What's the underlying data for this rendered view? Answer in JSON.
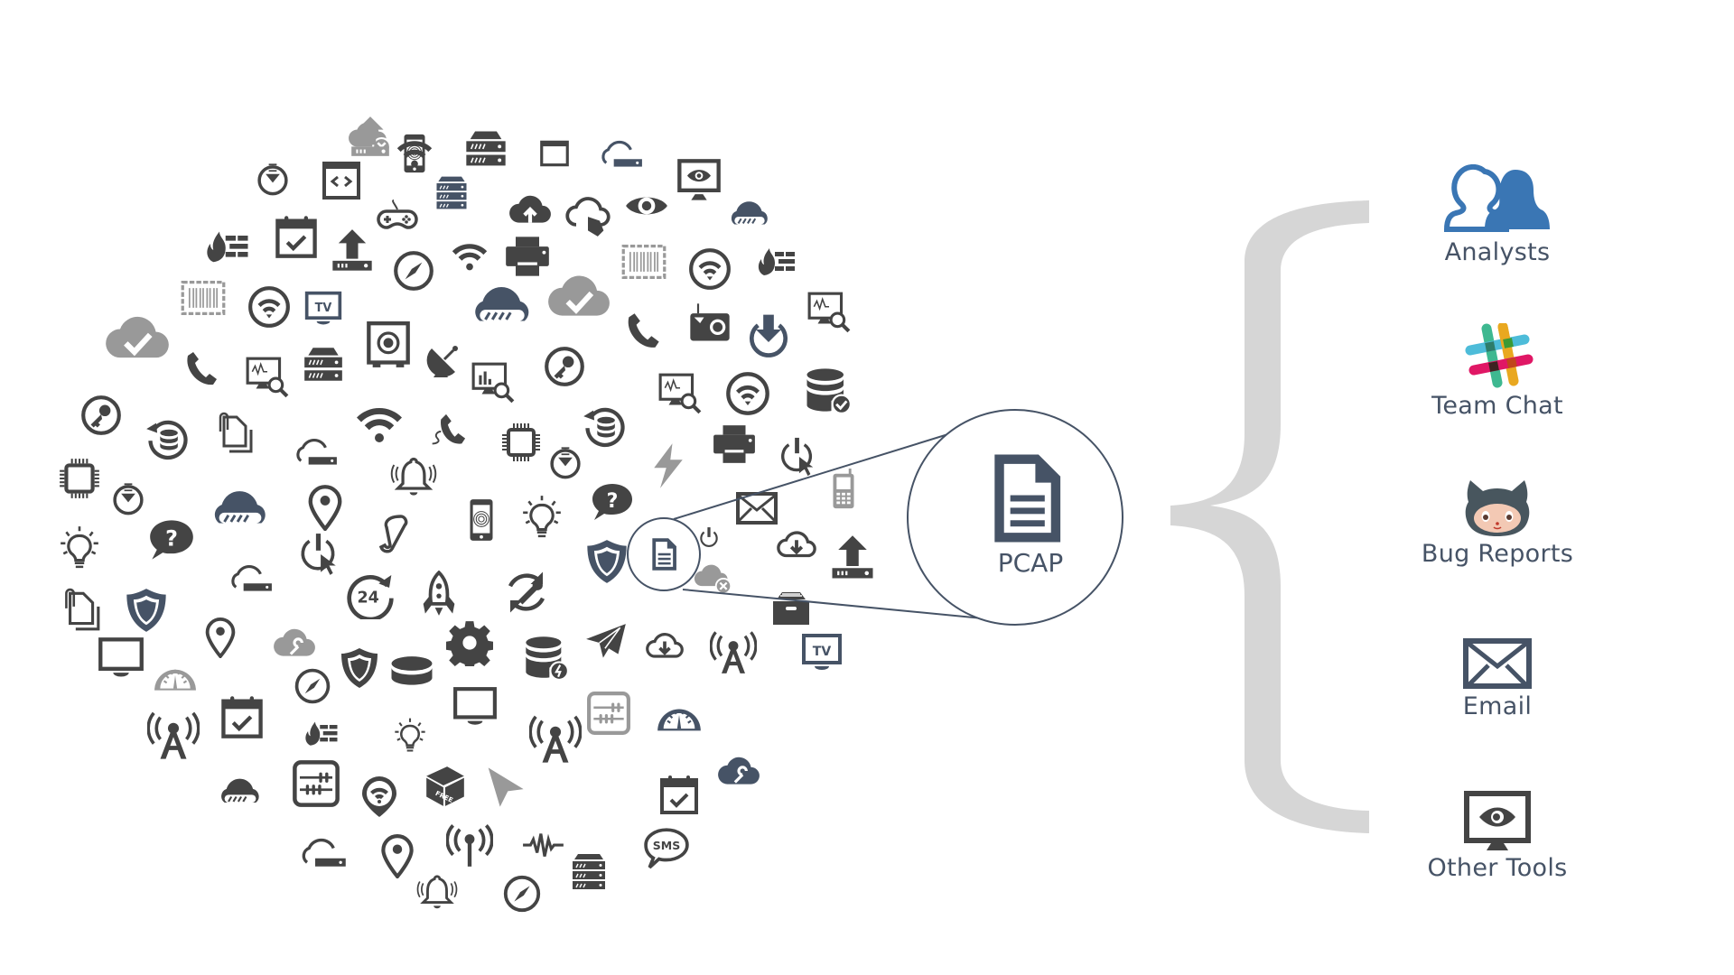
{
  "colors": {
    "icon_dark": "#444444",
    "icon_light": "#999999",
    "icon_slate": "#465366",
    "brace": "#d6d6d6",
    "label": "#465366",
    "analysts_blue": "#3a76b4"
  },
  "icon_cloud": {
    "icons": [
      "cloud-error-icon",
      "fingerprint-phone-icon",
      "server-icon",
      "browser-window-icon",
      "cloud-server-icon",
      "download-circle-icon",
      "code-window-icon",
      "server-stack-icon",
      "gamepad-icon",
      "cloud-upload-icon",
      "cloud-touch-icon",
      "eye-icon",
      "monitor-eye-icon",
      "cloud-progress-icon",
      "firewall-icon",
      "calendar-check-icon",
      "upload-server-icon",
      "compass-icon",
      "wifi-icon",
      "printer-icon",
      "barcode-icon",
      "wifi-circle-icon",
      "firewall-icon",
      "barcode-icon",
      "wifi-circle-icon",
      "tv-icon",
      "cloud-progress-icon",
      "cloud-check-icon",
      "phone-icon",
      "radio-icon",
      "power-download-icon",
      "monitor-search-icon",
      "cloud-check-icon",
      "phone-icon",
      "monitor-search-icon",
      "server-icon",
      "safe-icon",
      "satellite-dish-icon",
      "chart-search-icon",
      "key-circle-icon",
      "monitor-search-icon",
      "wifi-circle-icon",
      "database-check-icon",
      "key-circle-icon",
      "database-refresh-icon",
      "attachment-icon",
      "cloud-server-icon",
      "wifi-icon",
      "phone-cord-icon",
      "chip-icon",
      "database-refresh-icon",
      "lightning-icon",
      "printer-icon",
      "power-cursor-icon",
      "mobile-phone-icon",
      "chip-icon",
      "download-circle-icon",
      "bell-icon",
      "download-circle-icon",
      "help-bubble-icon",
      "power-icon",
      "envelope-icon",
      "lightbulb-icon",
      "help-bubble-icon",
      "cloud-progress-icon",
      "location-pin-icon",
      "scroll-icon",
      "fingerprint-phone-icon",
      "lightbulb-icon",
      "shield-icon",
      "cloud-download-icon",
      "upload-server-icon",
      "cloud-server-icon",
      "power-cursor-icon",
      "clock-24-icon",
      "rocket-icon",
      "refresh-wrench-icon",
      "cloud-error-icon",
      "archive-box-icon",
      "attachment-icon",
      "shield-icon",
      "location-pin-icon",
      "cloud-wrench-icon",
      "gear-icon",
      "database-lightning-icon",
      "paper-plane-icon",
      "cloud-download-icon",
      "antenna-tower-icon",
      "tv-icon",
      "monitor-icon",
      "gauge-icon",
      "compass-icon",
      "shield-icon",
      "database-icon",
      "antenna-tower-icon",
      "calendar-check-icon",
      "firewall-icon",
      "lightbulb-icon",
      "monitor-icon",
      "antenna-tower-icon",
      "switch-panel-icon",
      "gauge-icon",
      "cloud-progress-icon",
      "switch-panel-icon",
      "wifi-pin-icon",
      "package-icon",
      "cursor-arrow-icon",
      "calendar-check-icon",
      "cloud-wrench-icon",
      "cloud-server-icon",
      "location-pin-icon",
      "antenna-icon",
      "waveform-icon",
      "server-stack-icon",
      "sms-bubble-icon",
      "bell-icon",
      "compass-icon",
      "upload-server-icon",
      "wifi-icon"
    ]
  },
  "zoom_callout": {
    "label": "PCAP",
    "icon": "document-icon"
  },
  "destinations": [
    {
      "label": "Analysts",
      "icon": "users-icon"
    },
    {
      "label": "Team Chat",
      "icon": "slack-icon"
    },
    {
      "label": "Bug Reports",
      "icon": "octocat-icon"
    },
    {
      "label": "Email",
      "icon": "envelope-icon"
    },
    {
      "label": "Other Tools",
      "icon": "monitor-eye-icon"
    }
  ]
}
